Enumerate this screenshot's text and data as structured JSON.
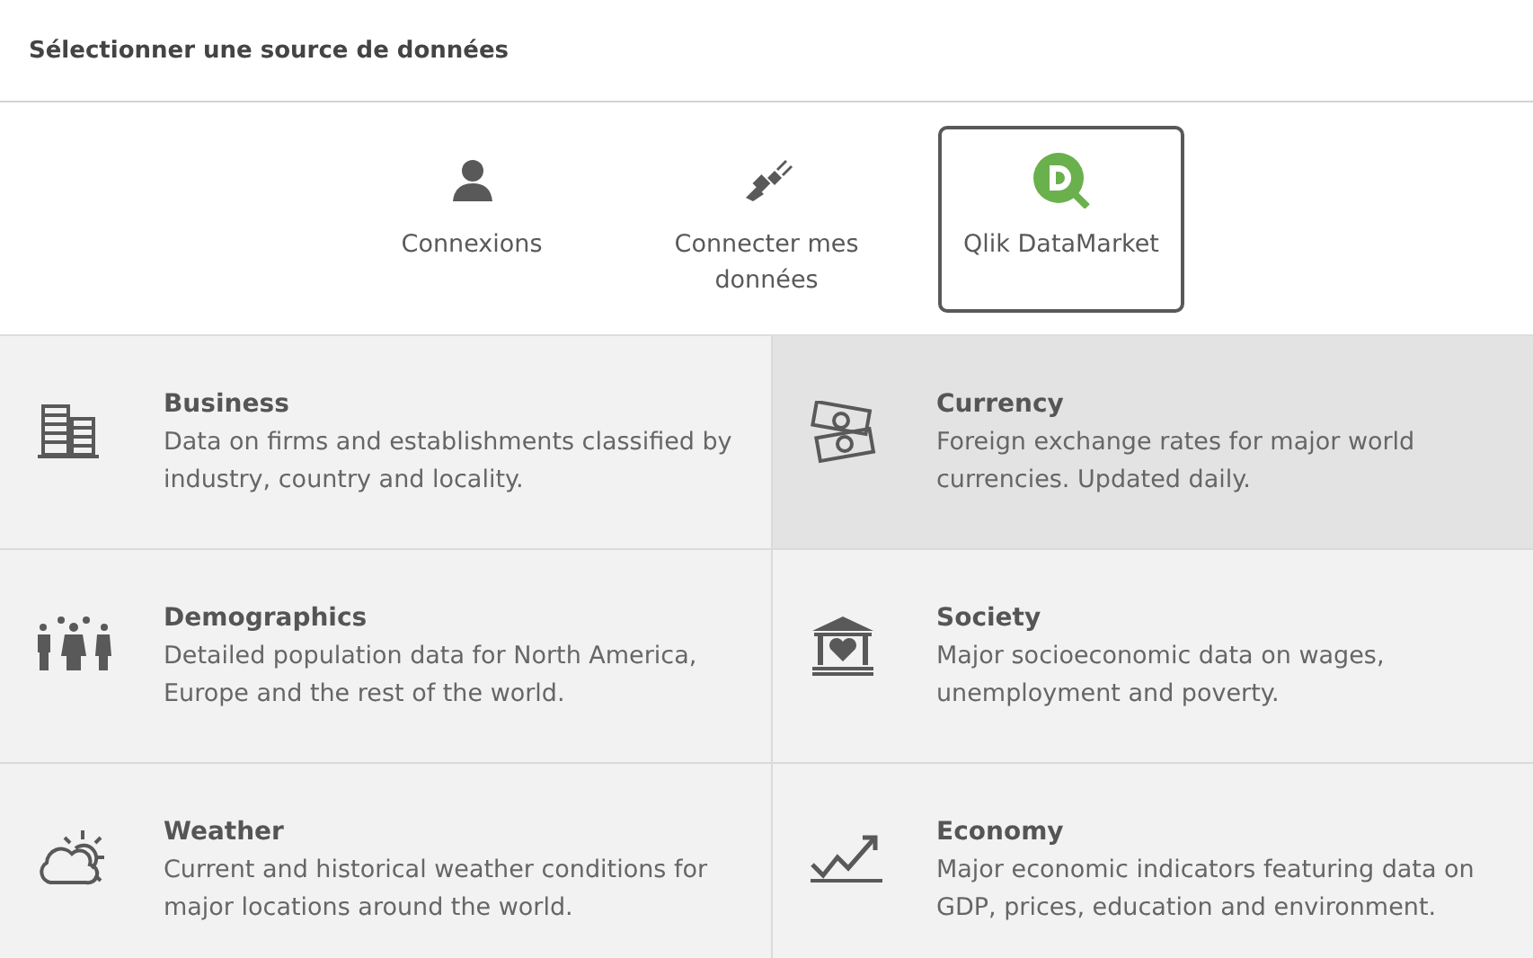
{
  "header": {
    "title": "Sélectionner une source de données"
  },
  "tabs": [
    {
      "label": "Connexions",
      "selected": false
    },
    {
      "label": "Connecter mes données",
      "selected": false
    },
    {
      "label": "Qlik DataMarket",
      "selected": true
    }
  ],
  "tiles": [
    {
      "title": "Business",
      "description": "Data on firms and establishments classified by industry, country and locality.",
      "highlighted": false
    },
    {
      "title": "Currency",
      "description": "Foreign exchange rates for major world currencies. Updated daily.",
      "highlighted": true
    },
    {
      "title": "Demographics",
      "description": "Detailed population data for North America, Europe and the rest of the world.",
      "highlighted": false
    },
    {
      "title": "Society",
      "description": "Major socioeconomic data on wages, unemployment and poverty.",
      "highlighted": false
    },
    {
      "title": "Weather",
      "description": "Current and historical weather conditions for major locations around the world.",
      "highlighted": false
    },
    {
      "title": "Economy",
      "description": "Major economic indicators featuring data on GDP, prices, education and environment.",
      "highlighted": false
    }
  ]
}
